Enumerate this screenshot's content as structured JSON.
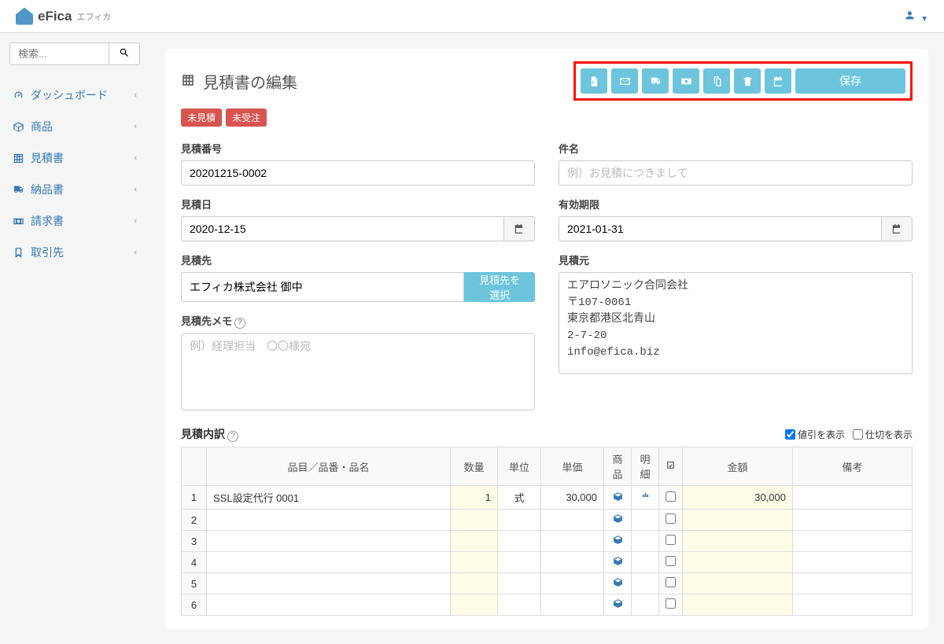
{
  "brand": {
    "name": "eFica",
    "sub": "エフィカ"
  },
  "search": {
    "placeholder": "検索..."
  },
  "nav": [
    {
      "label": "ダッシュボード"
    },
    {
      "label": "商品"
    },
    {
      "label": "見積書"
    },
    {
      "label": "納品書"
    },
    {
      "label": "請求書"
    },
    {
      "label": "取引先"
    }
  ],
  "page": {
    "title": "見積書の編集"
  },
  "badges": [
    "未見積",
    "未受注"
  ],
  "actions": {
    "save": "保存"
  },
  "form": {
    "quote_no": {
      "label": "見積番号",
      "value": "20201215-0002"
    },
    "subject": {
      "label": "件名",
      "placeholder": "例）お見積につきまして"
    },
    "quote_date": {
      "label": "見積日",
      "value": "2020-12-15"
    },
    "valid_until": {
      "label": "有効期限",
      "value": "2021-01-31"
    },
    "client": {
      "label": "見積先",
      "value": "エフィカ株式会社 御中",
      "select_btn": "見積先を選択"
    },
    "sender": {
      "label": "見積元",
      "value": "エアロソニック合同会社\n〒107-0061\n東京都港区北青山\n2-7-20\ninfo@efica.biz"
    },
    "client_memo": {
      "label": "見積先メモ",
      "placeholder": "例）経理担当　〇〇様宛"
    }
  },
  "lines": {
    "title": "見積内訳",
    "opt_discount": "値引を表示",
    "opt_partition": "仕切を表示",
    "headers": {
      "name": "品目／品番・品名",
      "qty": "数量",
      "unit": "単位",
      "price": "単価",
      "product": "商品",
      "detail": "明細",
      "amount": "金額",
      "note": "備考"
    },
    "rows": [
      {
        "n": "1",
        "name": "SSL設定代行 0001",
        "qty": "1",
        "unit": "式",
        "price": "30,000",
        "amount": "30,000"
      },
      {
        "n": "2",
        "name": "",
        "qty": "",
        "unit": "",
        "price": "",
        "amount": ""
      },
      {
        "n": "3",
        "name": "",
        "qty": "",
        "unit": "",
        "price": "",
        "amount": ""
      },
      {
        "n": "4",
        "name": "",
        "qty": "",
        "unit": "",
        "price": "",
        "amount": ""
      },
      {
        "n": "5",
        "name": "",
        "qty": "",
        "unit": "",
        "price": "",
        "amount": ""
      },
      {
        "n": "6",
        "name": "",
        "qty": "",
        "unit": "",
        "price": "",
        "amount": ""
      }
    ]
  }
}
